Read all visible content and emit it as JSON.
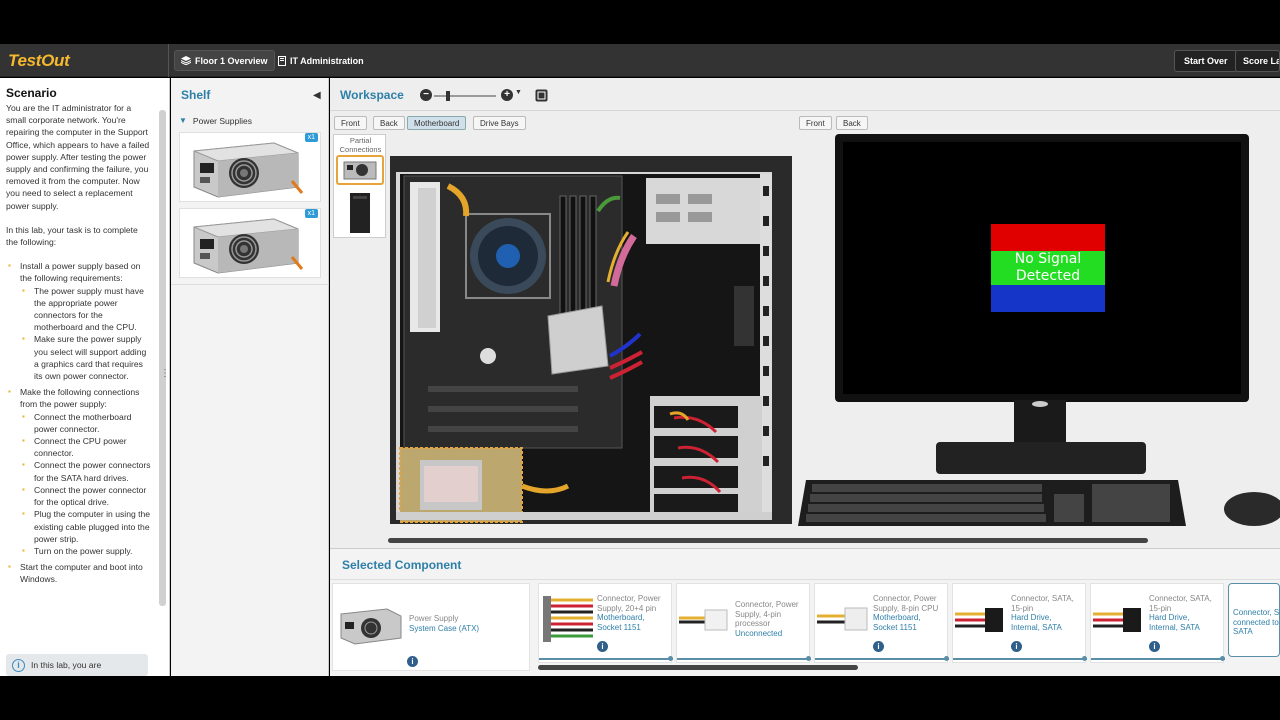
{
  "app": {
    "logo": "TestOut"
  },
  "topbar": {
    "floor_label": "Floor 1 Overview",
    "admin_label": "IT Administration",
    "start_over": "Start Over",
    "score_lab": "Score Lab"
  },
  "scenario": {
    "title": "Scenario",
    "intro": "You are the IT administrator for a small corporate network. You're repairing the computer in the Support Office, which appears to have a failed power supply. After testing the power supply and confirming the failure, you removed it from the computer. Now you need to select a replacement power supply.",
    "task_intro": "In this lab, your task is to complete the following:",
    "items": [
      {
        "text": "Install a power supply based on the following requirements:",
        "sub": [
          "The power supply must have the appropriate power connectors for the motherboard and the CPU.",
          " Make sure the power supply you select will support adding a graphics card that requires its own power connector."
        ]
      },
      {
        "text": "Make the following connections from the power supply:",
        "sub": [
          "Connect the motherboard power connector.",
          "Connect the CPU power connector.",
          "Connect the power connectors for the SATA hard drives.",
          "Connect the power connector for the optical drive.",
          "Plug the computer in using the existing cable plugged into the power strip.",
          "Turn on the power supply."
        ]
      },
      {
        "text": "Start the computer and boot into Windows.",
        "sub": []
      }
    ],
    "note": "In this lab, you are"
  },
  "shelf": {
    "title": "Shelf",
    "category": "Power Supplies",
    "items": [
      {
        "badge": "x1"
      },
      {
        "badge": "x1"
      }
    ]
  },
  "workspace": {
    "title": "Workspace",
    "left_views": [
      "Front",
      "Back",
      "Motherboard",
      "Drive Bays"
    ],
    "active_view": "Motherboard",
    "right_views": [
      "Front",
      "Back"
    ],
    "partial_label": "Partial Connections",
    "monitor_text_1": "No Signal",
    "monitor_text_2": "Detected",
    "colors": {
      "red": "#e00000",
      "green": "#22dd22",
      "blue": "#1535c8"
    }
  },
  "selected": {
    "title": "Selected Component",
    "main": {
      "line1": "Power Supply",
      "line2": "System Case (ATX)"
    },
    "connectors": [
      {
        "l1": "Connector, Power",
        "l2": "Supply, 20+4 pin",
        "l3": "Motherboard,",
        "l4": "Socket 1151"
      },
      {
        "l1": "Connector, Power",
        "l2": "Supply, 4-pin",
        "l3": "processor",
        "l4": "Unconnected"
      },
      {
        "l1": "Connector, Power",
        "l2": "Supply, 8-pin CPU",
        "l3": "Motherboard,",
        "l4": "Socket 1151"
      },
      {
        "l1": "Connector, SATA,",
        "l2": "15-pin",
        "l3": "Hard Drive,",
        "l4": "Internal, SATA"
      },
      {
        "l1": "Connector, SATA,",
        "l2": "15-pin",
        "l3": "Hard Drive,",
        "l4": "Internal, SATA"
      },
      {
        "l1": "Connector, SA",
        "l2": "connected to",
        "l3": "SATA",
        "l4": ""
      }
    ]
  }
}
